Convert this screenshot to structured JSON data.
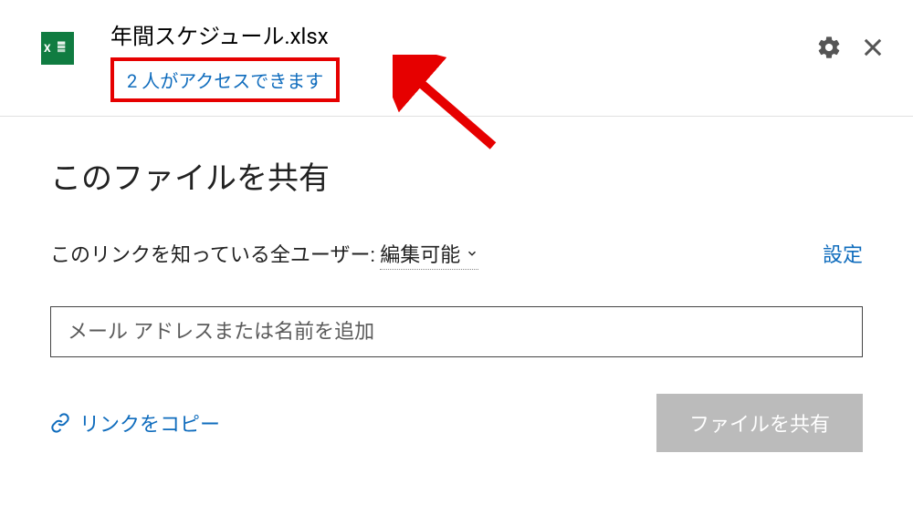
{
  "header": {
    "file_icon_label": "X",
    "file_name": "年間スケジュール.xlsx",
    "access_text": "2 人がアクセスできます"
  },
  "content": {
    "share_title": "このファイルを共有",
    "link_text_prefix": "このリンクを知っている全ユーザー: ",
    "permission_label": "編集可能",
    "settings_label": "設定",
    "email_placeholder": "メール アドレスまたは名前を追加",
    "copy_link_label": "リンクをコピー",
    "share_button_label": "ファイルを共有"
  }
}
